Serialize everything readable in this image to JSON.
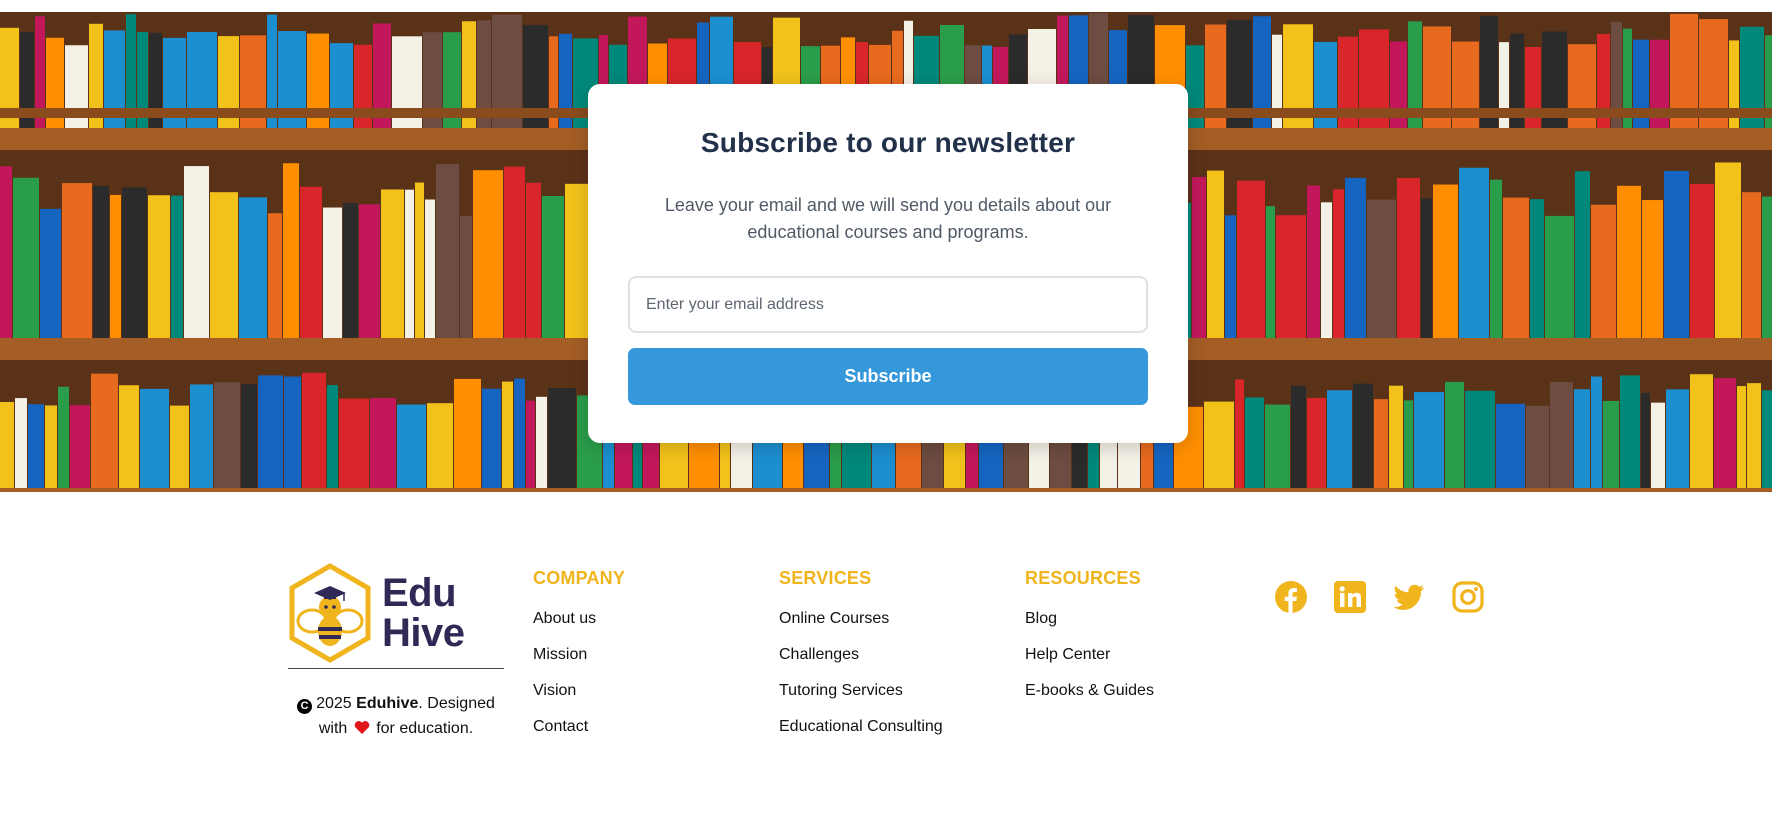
{
  "newsletter": {
    "title": "Subscribe to our newsletter",
    "description": "Leave your email and we will send you details about our educational courses and programs.",
    "email_placeholder": "Enter your email address",
    "email_value": "",
    "button_label": "Subscribe"
  },
  "brand": {
    "logo_line1": "Edu",
    "logo_line2": "Hive",
    "copyright_year": "2025",
    "copyright_name": "Eduhive",
    "copyright_mid": ". Designed with",
    "copyright_end": "for education."
  },
  "footer": {
    "columns": [
      {
        "heading": "COMPANY",
        "links": [
          "About us",
          "Mission",
          "Vision",
          "Contact"
        ]
      },
      {
        "heading": "SERVICES",
        "links": [
          "Online Courses",
          "Challenges",
          "Tutoring Services",
          "Educational Consulting"
        ]
      },
      {
        "heading": "RESOURCES",
        "links": [
          "Blog",
          "Help Center",
          "E-books & Guides"
        ]
      }
    ],
    "social": [
      "facebook-icon",
      "linkedin-icon",
      "twitter-icon",
      "instagram-icon"
    ]
  },
  "colors": {
    "accent": "#f0b41c",
    "button": "#3498db",
    "title": "#22314a",
    "logo_text": "#2f2a55"
  }
}
